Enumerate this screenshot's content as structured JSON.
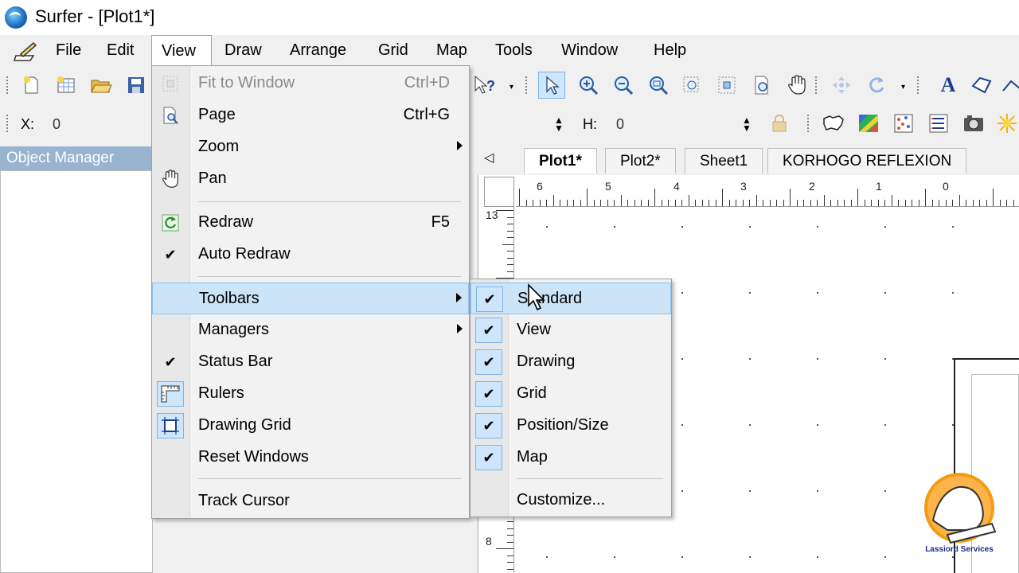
{
  "window": {
    "title": "Surfer - [Plot1*]"
  },
  "menubar": {
    "items": [
      "File",
      "Edit",
      "View",
      "Draw",
      "Arrange",
      "Grid",
      "Map",
      "Tools",
      "Window",
      "Help"
    ],
    "active": "View"
  },
  "position_bar": {
    "x_label": "X:",
    "x_value": "0",
    "h_label": "H:",
    "h_value": "0"
  },
  "object_manager": {
    "title": "Object Manager"
  },
  "doc_tabs": [
    "Plot1*",
    "Plot2*",
    "Sheet1",
    "KORHOGO REFLEXION"
  ],
  "rulers": {
    "h_labels": [
      "6",
      "5",
      "4",
      "3",
      "2",
      "1",
      "0"
    ],
    "v_labels": [
      "13",
      "8"
    ]
  },
  "view_menu": {
    "items": [
      {
        "label": "Fit to Window",
        "shortcut": "Ctrl+D",
        "icon": "fit-window-icon",
        "disabled": true
      },
      {
        "label": "Page",
        "shortcut": "Ctrl+G",
        "icon": "page-icon"
      },
      {
        "label": "Zoom",
        "submenu": true
      },
      {
        "label": "Pan",
        "icon": "hand-icon"
      },
      {
        "label": "Redraw",
        "shortcut": "F5",
        "icon": "redraw-icon"
      },
      {
        "label": "Auto Redraw",
        "checked": true
      },
      {
        "label": "Toolbars",
        "submenu": true,
        "highlighted": true
      },
      {
        "label": "Managers",
        "submenu": true
      },
      {
        "label": "Status Bar",
        "checked": true
      },
      {
        "label": "Rulers",
        "icon": "ruler-icon",
        "checked": true
      },
      {
        "label": "Drawing Grid",
        "icon": "drawing-grid-icon",
        "checked": true
      },
      {
        "label": "Reset Windows"
      },
      {
        "label": "Track Cursor"
      }
    ]
  },
  "toolbars_submenu": {
    "items": [
      {
        "label": "Standard",
        "checked": true,
        "highlighted": true
      },
      {
        "label": "View",
        "checked": true
      },
      {
        "label": "Drawing",
        "checked": true
      },
      {
        "label": "Grid",
        "checked": true
      },
      {
        "label": "Position/Size",
        "checked": true
      },
      {
        "label": "Map",
        "checked": true
      },
      {
        "label": "Customize..."
      }
    ]
  },
  "watermark": {
    "text": "Lassiord Services"
  },
  "colors": {
    "highlight": "#cce4f7",
    "highlight_border": "#8ec1ea",
    "checkbox_bg": "#cde6fb",
    "panel_header": "#99b4d1"
  }
}
